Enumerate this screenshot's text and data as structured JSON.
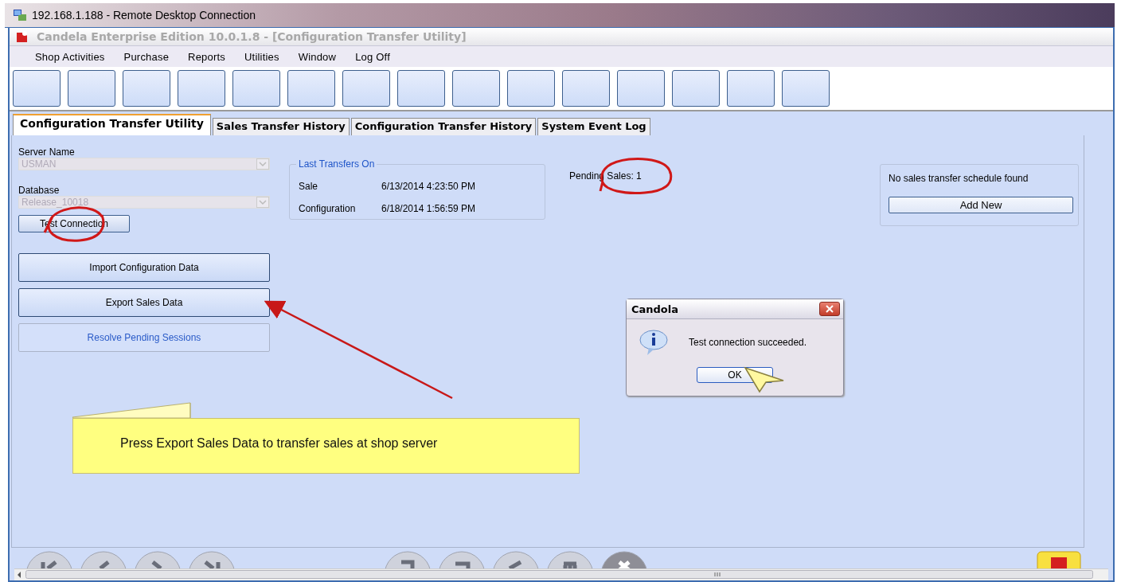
{
  "remote_window": {
    "title": "192.168.1.188 - Remote Desktop Connection"
  },
  "app_window": {
    "title": "Candela Enterprise Edition 10.0.1.8 - [Configuration Transfer Utility]"
  },
  "menu": [
    "Shop Activities",
    "Purchase",
    "Reports",
    "Utilities",
    "Window",
    "Log Off"
  ],
  "tabs": [
    {
      "label": "Configuration Transfer Utility",
      "selected": true
    },
    {
      "label": "Sales Transfer History",
      "selected": false
    },
    {
      "label": "Configuration Transfer History",
      "selected": false
    },
    {
      "label": "System Event Log",
      "selected": false
    }
  ],
  "server_name": {
    "label": "Server Name",
    "value": "USMAN",
    "disabled": true
  },
  "database": {
    "label": "Database",
    "value": "Release_10018",
    "disabled": true
  },
  "test_connection_button": "Test Connection",
  "action_buttons": [
    {
      "label": "Import Configuration Data",
      "disabled": false
    },
    {
      "label": "Export Sales Data",
      "disabled": false
    },
    {
      "label": "Resolve Pending Sessions",
      "disabled": true
    }
  ],
  "last_transfers": {
    "title": "Last Transfers On",
    "rows": [
      {
        "label": "Sale",
        "value": "6/13/2014 4:23:50 PM"
      },
      {
        "label": "Configuration",
        "value": "6/18/2014 1:56:59 PM"
      }
    ]
  },
  "pending_sales": "Pending Sales: 1",
  "schedule": {
    "message": "No sales transfer schedule found",
    "button": "Add New"
  },
  "dialog": {
    "title": "Candola",
    "message": "Test connection succeeded.",
    "button": "OK"
  },
  "callout": "Press Export Sales Data to transfer sales at shop server"
}
